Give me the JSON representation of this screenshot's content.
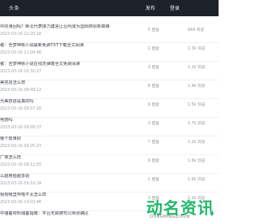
{
  "header": {
    "logo": "头条",
    "publish": "发布",
    "login": "登录"
  },
  "posts": [
    {
      "title": "中的演回吗？新北代表接力建言让台州成为国际商贸新高峰",
      "time": "2023-03-16 12:25:18",
      "replies": "5 回复",
      "views": "844 浏览"
    },
    {
      "title": "者：吾梦神彬小说最新免费TXT下载全文阅读",
      "time": "2023-03-16 11:09:48",
      "replies": "1 回复",
      "views": "1.3k 浏览"
    },
    {
      "title": "者：吾梦神彬小说在线无弹窗全文免费阅读",
      "time": "2023-03-16 10:32:27",
      "replies": "3 回复",
      "views": "1.2k 浏览"
    },
    {
      "title": "美容店怎么样",
      "time": "2023-03-16 09:49:12",
      "replies": "8 回复",
      "views": "1.4k 浏览"
    },
    {
      "title": "光美容店是真的吗",
      "time": "2023-03-16 09:57:16",
      "replies": "9 回复",
      "views": "1.5k 浏览"
    },
    {
      "title": "电感吗",
      "time": "2023-03-16 09:09:37",
      "replies": "3 回复",
      "views": "1.7k 浏览"
    },
    {
      "title": "哪个效果好",
      "time": "2023-03-16 09:05:27",
      "replies": "7 回复",
      "views": "1.2k 浏览"
    },
    {
      "title": "厂家怎么样",
      "time": "2023-03-16 09:12:55",
      "replies": "9 回复",
      "views": "1.6k 浏览"
    },
    {
      "title": "么越用脸越多斑",
      "time": "2023-03-16 09:16:34",
      "replies": "1 回复",
      "views": "1.6k 浏览"
    },
    {
      "title": "我有哪里呼吸不太怎么样",
      "time": "2023-03-16 14:02:46",
      "replies": "3 回复",
      "views": "1.2k 浏览"
    },
    {
      "title": "中储备材料储备指南：平台无故被驾公照张确见",
      "time": "",
      "replies": "",
      "views": ""
    }
  ],
  "watermark": {
    "brand": "动名资讯",
    "sub": "DONGMINGZIXUN"
  },
  "colors": {
    "topbar": "#1d2128",
    "watermark": "#21b86a"
  }
}
